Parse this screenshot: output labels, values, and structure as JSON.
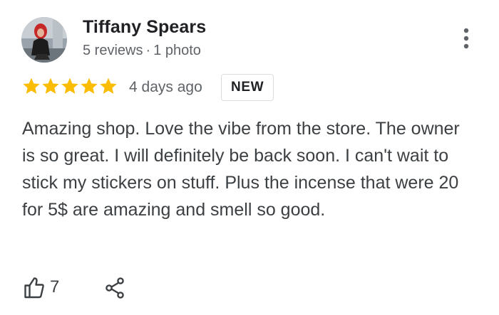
{
  "reviewer": {
    "name": "Tiffany Spears",
    "reviews": "5 reviews",
    "separator": "·",
    "photos": "1 photo",
    "avatar_icon": "profile-photo"
  },
  "rating": {
    "stars": 5,
    "max": 5,
    "color": "#fbbc04"
  },
  "posted": "4 days ago",
  "badge": "NEW",
  "review": {
    "text": "Amazing shop. Love the vibe from the store. The owner is so great. I will definitely be back soon. I can't wait to stick my stickers on stuff. Plus the incense that were 20 for 5$ are amazing and smell so good."
  },
  "actions": {
    "like_icon": "thumb-up-outline",
    "like_count": "7",
    "share_icon": "share",
    "more_icon": "more-vert"
  }
}
